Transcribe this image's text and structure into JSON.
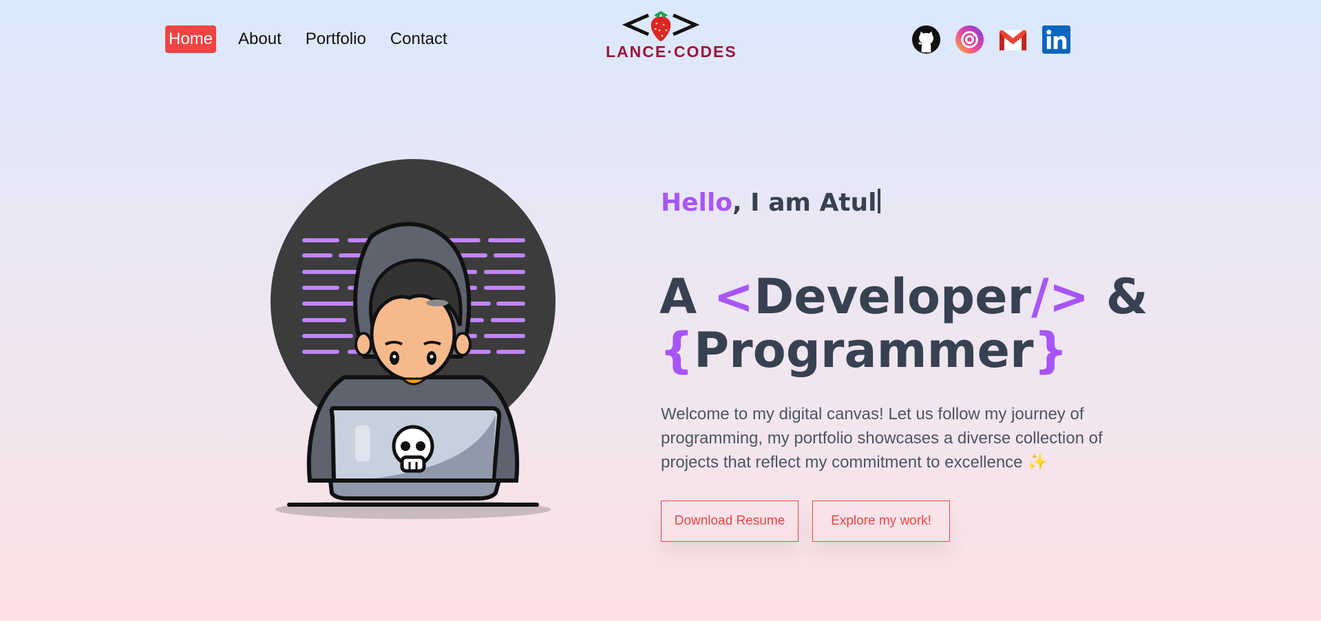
{
  "nav": {
    "items": [
      {
        "label": "Home",
        "active": true
      },
      {
        "label": "About",
        "active": false
      },
      {
        "label": "Portfolio",
        "active": false
      },
      {
        "label": "Contact",
        "active": false
      }
    ]
  },
  "logo": {
    "text": "LANCE·CODES",
    "icon": "strawberry-code-brackets-icon"
  },
  "socials": [
    {
      "name": "github",
      "icon": "github-icon"
    },
    {
      "name": "instagram",
      "icon": "instagram-icon"
    },
    {
      "name": "gmail",
      "icon": "gmail-icon"
    },
    {
      "name": "linkedin",
      "icon": "linkedin-icon"
    }
  ],
  "hero": {
    "greeting_accent": "Hello",
    "greeting_rest": ", I am Atul",
    "headline": {
      "a": "A ",
      "lt": "<",
      "developer": "Developer",
      "close": "/>",
      "amp": " &",
      "lbrace": "{",
      "programmer": "Programmer",
      "rbrace": "}"
    },
    "welcome": "Welcome to my digital canvas! Let us follow my journey of programming, my portfolio showcases a diverse collection of projects that reflect my commitment to excellence ✨",
    "buttons": {
      "resume": "Download Resume",
      "work": "Explore my work!"
    }
  },
  "colors": {
    "accent": "#a855f7",
    "button": "#ef4444",
    "text": "#374151"
  }
}
